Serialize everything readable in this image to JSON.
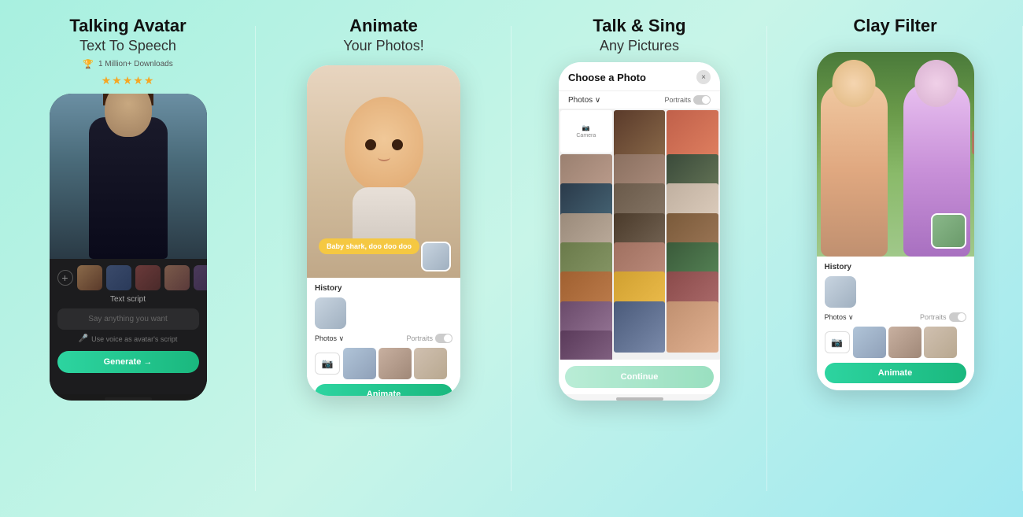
{
  "panels": [
    {
      "id": "panel1",
      "title": "Talking Avatar",
      "subtitle": "Text To Speech",
      "badge": "1 Million+ Downloads",
      "stars": "★★★★★",
      "text_script_label": "Text script",
      "text_script_placeholder": "Say anything  you want",
      "voice_label": "Use voice as avatar's script",
      "generate_label": "Generate →",
      "thumbnails": [
        "thumb1",
        "thumb2",
        "thumb3",
        "thumb4",
        "thumb5"
      ]
    },
    {
      "id": "panel2",
      "title": "Animate",
      "subtitle": "Your Photos!",
      "speech_bubble": "Baby shark, doo doo doo",
      "history_label": "History",
      "photos_label": "Photos ∨",
      "portraits_label": "Portraits",
      "camera_label": "Camera",
      "animate_label": "Animate"
    },
    {
      "id": "panel3",
      "title": "Talk & Sing",
      "subtitle": "Any Pictures",
      "modal_title": "Choose a Photo",
      "close_label": "×",
      "photos_label": "Photos ∨",
      "portraits_label": "Portraits",
      "camera_label": "Camera",
      "continue_label": "Continue"
    },
    {
      "id": "panel4",
      "title": "Clay Filter",
      "subtitle": "",
      "history_label": "History",
      "photos_label": "Photos ∨",
      "portraits_label": "Portraits",
      "camera_label": "Camera",
      "animate_label": "Animate"
    }
  ],
  "colors": {
    "green_gradient_start": "#2dd4a0",
    "green_gradient_end": "#1ab87e",
    "background_start": "#a8f0e0",
    "background_end": "#a0e8f0"
  }
}
